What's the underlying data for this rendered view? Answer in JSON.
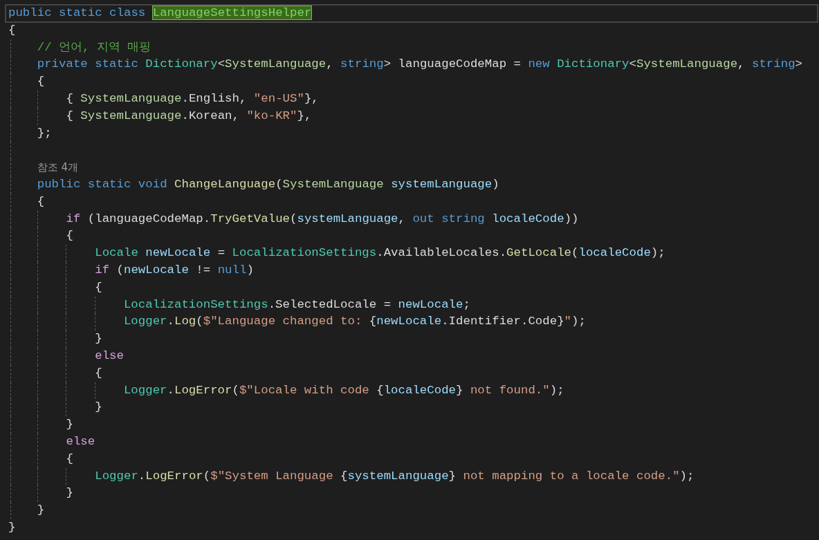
{
  "editor": {
    "lines": [
      {
        "kind": "code",
        "current": true,
        "tokens": [
          {
            "kind": "k",
            "text": "public static class "
          },
          {
            "kind": "t",
            "text": "LanguageSettingsHelper",
            "highlighted": true
          }
        ]
      },
      {
        "kind": "code",
        "tokens": [
          {
            "kind": "p",
            "text": "{"
          }
        ],
        "children": [
          {
            "kind": "code",
            "tokens": [
              {
                "kind": "cm",
                "text": "// 언어, 지역 매핑"
              }
            ]
          },
          {
            "kind": "code",
            "tokens": [
              {
                "kind": "k",
                "text": "private static "
              },
              {
                "kind": "t",
                "text": "Dictionary"
              },
              {
                "kind": "p",
                "text": "<"
              },
              {
                "kind": "e",
                "text": "SystemLanguage"
              },
              {
                "kind": "p",
                "text": ", "
              },
              {
                "kind": "k",
                "text": "string"
              },
              {
                "kind": "p",
                "text": "> languageCodeMap = "
              },
              {
                "kind": "k",
                "text": "new "
              },
              {
                "kind": "t",
                "text": "Dictionary"
              },
              {
                "kind": "p",
                "text": "<"
              },
              {
                "kind": "e",
                "text": "SystemLanguage"
              },
              {
                "kind": "p",
                "text": ", "
              },
              {
                "kind": "k",
                "text": "string"
              },
              {
                "kind": "p",
                "text": ">"
              }
            ]
          },
          {
            "kind": "code",
            "tokens": [
              {
                "kind": "p",
                "text": "{"
              }
            ],
            "children": [
              {
                "kind": "code",
                "tokens": [
                  {
                    "kind": "p",
                    "text": "{ "
                  },
                  {
                    "kind": "e",
                    "text": "SystemLanguage"
                  },
                  {
                    "kind": "p",
                    "text": ".English, "
                  },
                  {
                    "kind": "s",
                    "text": "\"en-US\""
                  },
                  {
                    "kind": "p",
                    "text": "},"
                  }
                ]
              },
              {
                "kind": "code",
                "tokens": [
                  {
                    "kind": "p",
                    "text": "{ "
                  },
                  {
                    "kind": "e",
                    "text": "SystemLanguage"
                  },
                  {
                    "kind": "p",
                    "text": ".Korean, "
                  },
                  {
                    "kind": "s",
                    "text": "\"ko-KR\""
                  },
                  {
                    "kind": "p",
                    "text": "},"
                  }
                ]
              }
            ]
          },
          {
            "kind": "code",
            "tokens": [
              {
                "kind": "p",
                "text": "};"
              }
            ]
          },
          {
            "kind": "blank"
          },
          {
            "kind": "codelens",
            "text": "참조 4개"
          },
          {
            "kind": "code",
            "tokens": [
              {
                "kind": "k",
                "text": "public static void "
              },
              {
                "kind": "m",
                "text": "ChangeLanguage"
              },
              {
                "kind": "p",
                "text": "("
              },
              {
                "kind": "e",
                "text": "SystemLanguage "
              },
              {
                "kind": "v",
                "text": "systemLanguage"
              },
              {
                "kind": "p",
                "text": ")"
              }
            ]
          },
          {
            "kind": "code",
            "tokens": [
              {
                "kind": "p",
                "text": "{"
              }
            ],
            "children": [
              {
                "kind": "code",
                "tokens": [
                  {
                    "kind": "c",
                    "text": "if"
                  },
                  {
                    "kind": "p",
                    "text": " (languageCodeMap."
                  },
                  {
                    "kind": "m",
                    "text": "TryGetValue"
                  },
                  {
                    "kind": "p",
                    "text": "("
                  },
                  {
                    "kind": "v",
                    "text": "systemLanguage"
                  },
                  {
                    "kind": "p",
                    "text": ", "
                  },
                  {
                    "kind": "k",
                    "text": "out string "
                  },
                  {
                    "kind": "v",
                    "text": "localeCode"
                  },
                  {
                    "kind": "p",
                    "text": "))"
                  }
                ]
              },
              {
                "kind": "code",
                "tokens": [
                  {
                    "kind": "p",
                    "text": "{"
                  }
                ],
                "children": [
                  {
                    "kind": "code",
                    "tokens": [
                      {
                        "kind": "t",
                        "text": "Locale "
                      },
                      {
                        "kind": "v",
                        "text": "newLocale"
                      },
                      {
                        "kind": "p",
                        "text": " = "
                      },
                      {
                        "kind": "t",
                        "text": "LocalizationSettings"
                      },
                      {
                        "kind": "p",
                        "text": ".AvailableLocales."
                      },
                      {
                        "kind": "m",
                        "text": "GetLocale"
                      },
                      {
                        "kind": "p",
                        "text": "("
                      },
                      {
                        "kind": "v",
                        "text": "localeCode"
                      },
                      {
                        "kind": "p",
                        "text": ");"
                      }
                    ]
                  },
                  {
                    "kind": "code",
                    "tokens": [
                      {
                        "kind": "c",
                        "text": "if"
                      },
                      {
                        "kind": "p",
                        "text": " ("
                      },
                      {
                        "kind": "v",
                        "text": "newLocale"
                      },
                      {
                        "kind": "p",
                        "text": " != "
                      },
                      {
                        "kind": "k",
                        "text": "null"
                      },
                      {
                        "kind": "p",
                        "text": ")"
                      }
                    ]
                  },
                  {
                    "kind": "code",
                    "tokens": [
                      {
                        "kind": "p",
                        "text": "{"
                      }
                    ],
                    "children": [
                      {
                        "kind": "code",
                        "tokens": [
                          {
                            "kind": "t",
                            "text": "LocalizationSettings"
                          },
                          {
                            "kind": "p",
                            "text": ".SelectedLocale = "
                          },
                          {
                            "kind": "v",
                            "text": "newLocale"
                          },
                          {
                            "kind": "p",
                            "text": ";"
                          }
                        ]
                      },
                      {
                        "kind": "code",
                        "tokens": [
                          {
                            "kind": "t",
                            "text": "Logger"
                          },
                          {
                            "kind": "p",
                            "text": "."
                          },
                          {
                            "kind": "m",
                            "text": "Log"
                          },
                          {
                            "kind": "p",
                            "text": "("
                          },
                          {
                            "kind": "s",
                            "text": "$\"Language changed to: "
                          },
                          {
                            "kind": "p",
                            "text": "{"
                          },
                          {
                            "kind": "v",
                            "text": "newLocale"
                          },
                          {
                            "kind": "p",
                            "text": ".Identifier.Code}"
                          },
                          {
                            "kind": "s",
                            "text": "\""
                          },
                          {
                            "kind": "p",
                            "text": ");"
                          }
                        ]
                      }
                    ]
                  },
                  {
                    "kind": "code",
                    "tokens": [
                      {
                        "kind": "p",
                        "text": "}"
                      }
                    ]
                  },
                  {
                    "kind": "code",
                    "tokens": [
                      {
                        "kind": "c",
                        "text": "else"
                      }
                    ]
                  },
                  {
                    "kind": "code",
                    "tokens": [
                      {
                        "kind": "p",
                        "text": "{"
                      }
                    ],
                    "children": [
                      {
                        "kind": "code",
                        "tokens": [
                          {
                            "kind": "t",
                            "text": "Logger"
                          },
                          {
                            "kind": "p",
                            "text": "."
                          },
                          {
                            "kind": "m",
                            "text": "LogError"
                          },
                          {
                            "kind": "p",
                            "text": "("
                          },
                          {
                            "kind": "s",
                            "text": "$\"Locale with code "
                          },
                          {
                            "kind": "p",
                            "text": "{"
                          },
                          {
                            "kind": "v",
                            "text": "localeCode"
                          },
                          {
                            "kind": "p",
                            "text": "}"
                          },
                          {
                            "kind": "s",
                            "text": " not found.\""
                          },
                          {
                            "kind": "p",
                            "text": ");"
                          }
                        ]
                      }
                    ]
                  },
                  {
                    "kind": "code",
                    "tokens": [
                      {
                        "kind": "p",
                        "text": "}"
                      }
                    ]
                  }
                ]
              },
              {
                "kind": "code",
                "tokens": [
                  {
                    "kind": "p",
                    "text": "}"
                  }
                ]
              },
              {
                "kind": "code",
                "tokens": [
                  {
                    "kind": "c",
                    "text": "else"
                  }
                ]
              },
              {
                "kind": "code",
                "tokens": [
                  {
                    "kind": "p",
                    "text": "{"
                  }
                ],
                "children": [
                  {
                    "kind": "code",
                    "tokens": [
                      {
                        "kind": "t",
                        "text": "Logger"
                      },
                      {
                        "kind": "p",
                        "text": "."
                      },
                      {
                        "kind": "m",
                        "text": "LogError"
                      },
                      {
                        "kind": "p",
                        "text": "("
                      },
                      {
                        "kind": "s",
                        "text": "$\"System Language "
                      },
                      {
                        "kind": "p",
                        "text": "{"
                      },
                      {
                        "kind": "v",
                        "text": "systemLanguage"
                      },
                      {
                        "kind": "p",
                        "text": "}"
                      },
                      {
                        "kind": "s",
                        "text": " not mapping to a locale code.\""
                      },
                      {
                        "kind": "p",
                        "text": ");"
                      }
                    ]
                  }
                ]
              },
              {
                "kind": "code",
                "tokens": [
                  {
                    "kind": "p",
                    "text": "}"
                  }
                ]
              }
            ]
          },
          {
            "kind": "code",
            "tokens": [
              {
                "kind": "p",
                "text": "}"
              }
            ]
          }
        ]
      },
      {
        "kind": "code",
        "tokens": [
          {
            "kind": "p",
            "text": "}"
          }
        ]
      }
    ]
  }
}
